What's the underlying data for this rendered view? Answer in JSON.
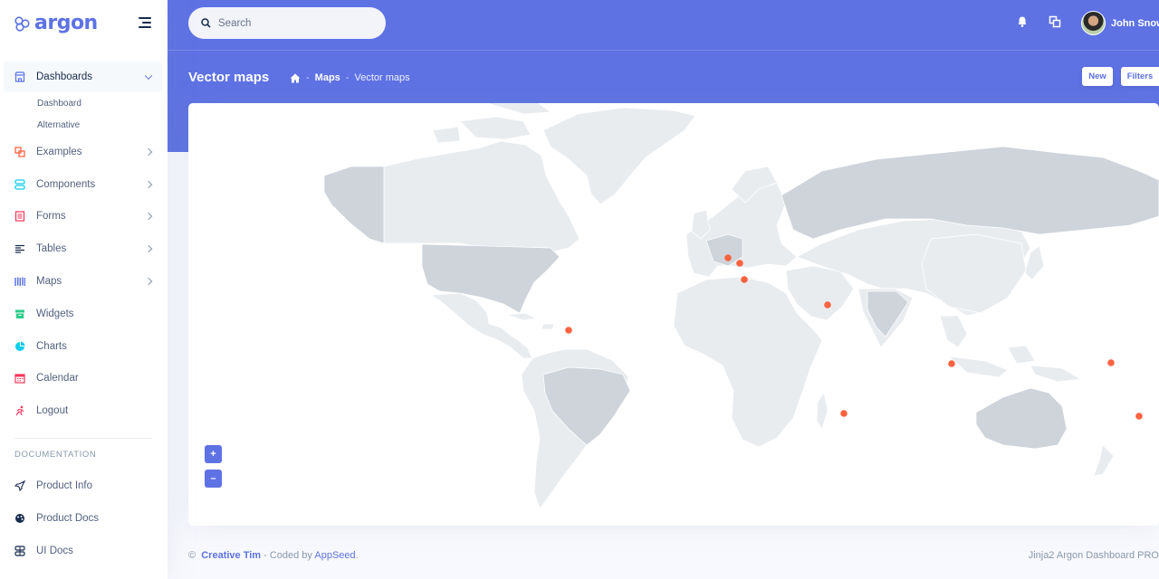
{
  "brand": {
    "name": "argon"
  },
  "sidebar": {
    "items": [
      {
        "label": "Dashboards",
        "icon": "shop-icon",
        "color": "#5e72e4"
      },
      {
        "label": "Examples",
        "icon": "ungroup-icon",
        "color": "#fb6340"
      },
      {
        "label": "Components",
        "icon": "ui-04-icon",
        "color": "#11cdef"
      },
      {
        "label": "Forms",
        "icon": "single-copy-icon",
        "color": "#f5365c"
      },
      {
        "label": "Tables",
        "icon": "align-left-icon",
        "color": "#172b4d"
      },
      {
        "label": "Maps",
        "icon": "map-big-icon",
        "color": "#5e72e4"
      },
      {
        "label": "Widgets",
        "icon": "archive-icon",
        "color": "#2dce89"
      },
      {
        "label": "Charts",
        "icon": "chart-pie-icon",
        "color": "#11cdef"
      },
      {
        "label": "Calendar",
        "icon": "calendar-icon",
        "color": "#f5365c"
      },
      {
        "label": "Logout",
        "icon": "user-run-icon",
        "color": "#f5365c"
      }
    ],
    "dashboard_sub": [
      "Dashboard",
      "Alternative"
    ],
    "doc_heading": "DOCUMENTATION",
    "docs": [
      {
        "label": "Product Info",
        "icon": "spaceship-icon"
      },
      {
        "label": "Product Docs",
        "icon": "palette-icon"
      },
      {
        "label": "UI Docs",
        "icon": "ui-04-icon"
      }
    ]
  },
  "header": {
    "search_placeholder": "Search",
    "user_name": "John Snow",
    "page_title": "Vector maps",
    "breadcrumb": [
      "Maps",
      "Vector maps"
    ],
    "new_label": "New",
    "filters_label": "Filters"
  },
  "map": {
    "zoom_in": "+",
    "zoom_out": "–",
    "land_color": "#e9ecef",
    "highlight_color": "#ced4da",
    "marker_color": "#fb6340",
    "markers": [
      {
        "name": "marker-marseille"
      },
      {
        "name": "marker-italy"
      },
      {
        "name": "marker-malta"
      },
      {
        "name": "marker-uae"
      },
      {
        "name": "marker-caribbean"
      },
      {
        "name": "marker-singapore"
      },
      {
        "name": "marker-pacific"
      },
      {
        "name": "marker-mauritius"
      },
      {
        "name": "marker-fiji"
      }
    ]
  },
  "footer": {
    "copyright": "©",
    "author": "Creative Tim",
    "coded_by": " - Coded by ",
    "seed": "AppSeed",
    "period": ".",
    "product": "Jinja2 Argon Dashboard PRO"
  }
}
